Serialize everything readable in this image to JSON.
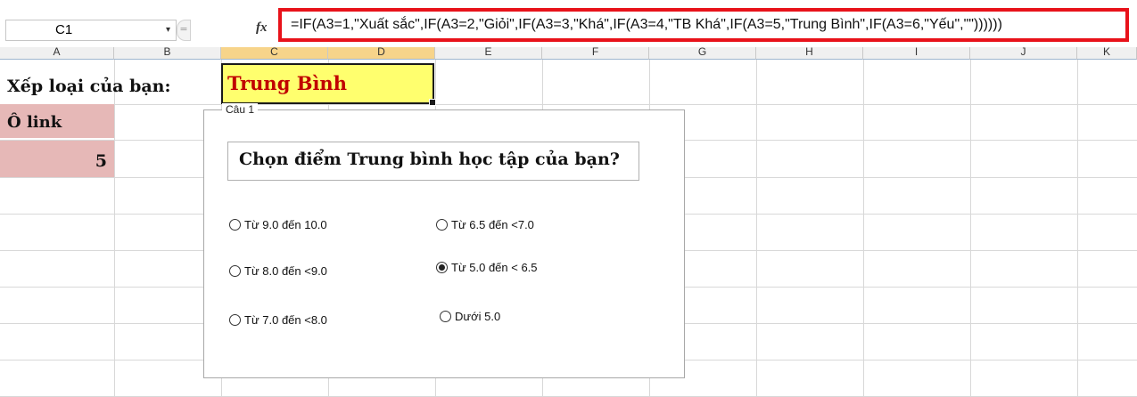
{
  "formula_bar": {
    "name_box": "C1",
    "name_box_arrow": "▾",
    "fx_label": "fx",
    "formula": "=IF(A3=1,\"Xuất sắc\",IF(A3=2,\"Giỏi\",IF(A3=3,\"Khá\",IF(A3=4,\"TB Khá\",IF(A3=5,\"Trung Bình\",IF(A3=6,\"Yếu\",\"\"))))))"
  },
  "columns": [
    "A",
    "B",
    "C",
    "D",
    "E",
    "F",
    "G",
    "H",
    "I",
    "J",
    "K"
  ],
  "selected_columns": [
    "C",
    "D"
  ],
  "cells": {
    "a1_label": "Xếp loại của bạn:",
    "c1_value": "Trung Bình",
    "a2_label": "Ô link",
    "a3_value": "5"
  },
  "group_box": {
    "label": "Câu 1",
    "question": "Chọn điểm Trung bình học tập của bạn?",
    "options": [
      {
        "label": "Từ 9.0 đến 10.0",
        "checked": false
      },
      {
        "label": "Từ 8.0 đến <9.0",
        "checked": false
      },
      {
        "label": "Từ 7.0 đến <8.0",
        "checked": false
      },
      {
        "label": "Từ 6.5 đến <7.0",
        "checked": false
      },
      {
        "label": "Từ 5.0 đến < 6.5",
        "checked": true
      },
      {
        "label": "Dưới 5.0",
        "checked": false
      }
    ]
  },
  "colors": {
    "highlight_border": "#e8121a",
    "c1_fill": "#ffff6e",
    "c1_text": "#c00000",
    "link_cell_fill": "#e6b8b7"
  }
}
